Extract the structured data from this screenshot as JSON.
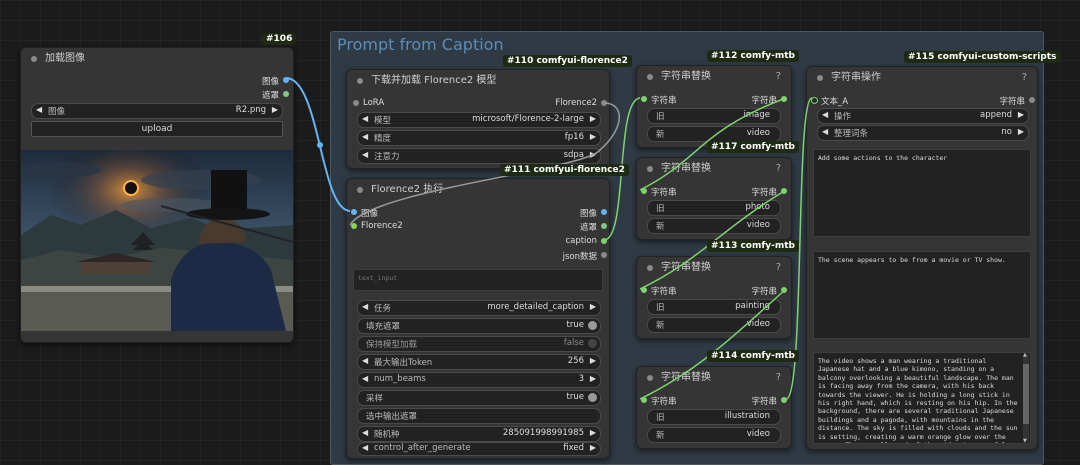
{
  "group": {
    "title": "Prompt from Caption"
  },
  "colors": {
    "image": "#64b5f6",
    "mask": "#81c784",
    "string": "#7fd36f",
    "green": "#7ed957",
    "badge_bg": "#1f2a12",
    "group_bg": "#2f3a44"
  },
  "badges": {
    "n106": "#106",
    "n110": "#110 comfyui-florence2",
    "n111": "#111 comfyui-florence2",
    "n112": "#112 comfy-mtb",
    "n117": "#117 comfy-mtb",
    "n113": "#113 comfy-mtb",
    "n114": "#114 comfy-mtb",
    "n115": "#115 comfyui-custom-scripts"
  },
  "load_image": {
    "title": "加载图像",
    "out_image": "图像",
    "out_mask": "遮罩",
    "image_label": "图像",
    "image_value": "R2.png",
    "upload": "upload",
    "preview_desc": "eclipse-scene-preview"
  },
  "download_florence": {
    "title": "下载并加载 Florence2 模型",
    "lora": "LoRA",
    "out": "Florence2",
    "model_label": "模型",
    "model_value": "microsoft/Florence-2-large",
    "precision_label": "精度",
    "precision_value": "fp16",
    "attention_label": "注意力",
    "attention_value": "sdpa"
  },
  "florence_run": {
    "title": "Florence2 执行",
    "in_image": "图像",
    "in_model": "Florence2",
    "out_image": "图像",
    "out_mask": "遮罩",
    "out_caption": "caption",
    "out_json": "json数据",
    "text_input_placeholder": "text_input",
    "task_label": "任务",
    "task_value": "more_detailed_caption",
    "fill_mask_label": "填充遮罩",
    "fill_mask_value": "true",
    "keep_model_label": "保持模型加载",
    "keep_model_value": "false",
    "max_token_label": "最大输出Token",
    "max_token_value": "256",
    "num_beams_label": "num_beams",
    "num_beams_value": "3",
    "sample_label": "采样",
    "sample_value": "true",
    "select_mask_label": "选中输出遮罩",
    "seed_label": "随机种",
    "seed_value": "285091998991985",
    "control_label": "control_after_generate",
    "control_value": "fixed"
  },
  "replace_nodes": [
    {
      "title": "字符串替换",
      "q": "?",
      "in": "字符串",
      "out": "字符串",
      "old_label": "旧",
      "old_value": "image",
      "new_label": "新",
      "new_value": "video"
    },
    {
      "title": "字符串替换",
      "q": "?",
      "in": "字符串",
      "out": "字符串",
      "old_label": "旧",
      "old_value": "photo",
      "new_label": "新",
      "new_value": "video"
    },
    {
      "title": "字符串替换",
      "q": "?",
      "in": "字符串",
      "out": "字符串",
      "old_label": "旧",
      "old_value": "painting",
      "new_label": "新",
      "new_value": "video"
    },
    {
      "title": "字符串替换",
      "q": "?",
      "in": "字符串",
      "out": "字符串",
      "old_label": "旧",
      "old_value": "illustration",
      "new_label": "新",
      "new_value": "video"
    }
  ],
  "string_op": {
    "title": "字符串操作",
    "in_text": "文本_A",
    "out": "字符串",
    "op_label": "操作",
    "op_value": "append",
    "trim_label": "整理词条",
    "trim_value": "no",
    "text_b": "Add some actions to the character",
    "text_c": "The scene appears to be from a movie or TV show.",
    "output_text": "The video shows a man wearing a traditional Japanese hat and a blue kimono, standing on a balcony overlooking a beautiful landscape. The man is facing away from the camera, with his back towards the viewer. He is holding a long stick in his right hand, which is resting on his hip. In the background, there are several traditional Japanese buildings and a pagoda, with mountains in the distance. The sky is filled with clouds and the sun is setting, creating a warm orange glow over the scene. The overall mood of the video is peaceful and serene.Add some actions to the"
  }
}
